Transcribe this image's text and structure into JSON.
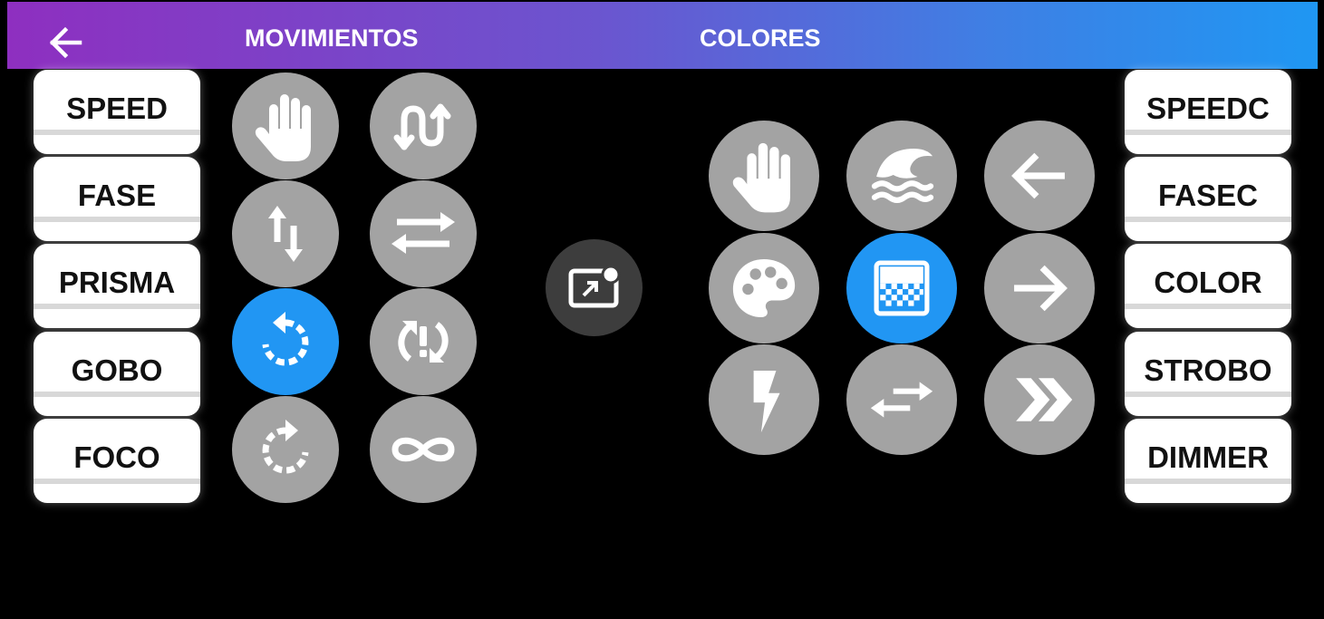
{
  "header": {
    "back_icon": "arrow-back-icon",
    "tabs": [
      {
        "label": "MOVIMIENTOS"
      },
      {
        "label": "COLORES"
      }
    ],
    "gradient": [
      "#8e2fc0",
      "#1f97f3"
    ]
  },
  "left_buttons": [
    {
      "label": "SPEED"
    },
    {
      "label": "FASE"
    },
    {
      "label": "PRISMA"
    },
    {
      "label": "GOBO"
    },
    {
      "label": "FOCO"
    }
  ],
  "right_buttons": [
    {
      "label": "SPEEDC"
    },
    {
      "label": "FASEC"
    },
    {
      "label": "COLOR"
    },
    {
      "label": "STROBO"
    },
    {
      "label": "DIMMER"
    }
  ],
  "movement_icons": [
    {
      "icon": "hand-icon",
      "active": false
    },
    {
      "icon": "u-turn-up-icon",
      "active": false
    },
    {
      "icon": "swap-vertical-icon",
      "active": false
    },
    {
      "icon": "swap-horizontal-icon",
      "active": false
    },
    {
      "icon": "rotate-counterclockwise-icon",
      "active": true
    },
    {
      "icon": "sync-problem-icon",
      "active": false
    },
    {
      "icon": "rotate-clockwise-icon",
      "active": false
    },
    {
      "icon": "infinity-icon",
      "active": false
    }
  ],
  "center_icon": "picture-in-picture-icon",
  "color_icons": [
    {
      "icon": "hand-icon",
      "active": false
    },
    {
      "icon": "tsunami-icon",
      "active": false
    },
    {
      "icon": "arrow-left-icon",
      "active": false
    },
    {
      "icon": "palette-icon",
      "active": false
    },
    {
      "icon": "gradient-icon",
      "active": true
    },
    {
      "icon": "arrow-right-icon",
      "active": false
    },
    {
      "icon": "flash-icon",
      "active": false
    },
    {
      "icon": "swap-arrows-icon",
      "active": false
    },
    {
      "icon": "double-chevron-right-icon",
      "active": false
    }
  ],
  "colors": {
    "accent": "#2196f3",
    "icon_button": "#a3a3a3",
    "background": "#000000"
  }
}
